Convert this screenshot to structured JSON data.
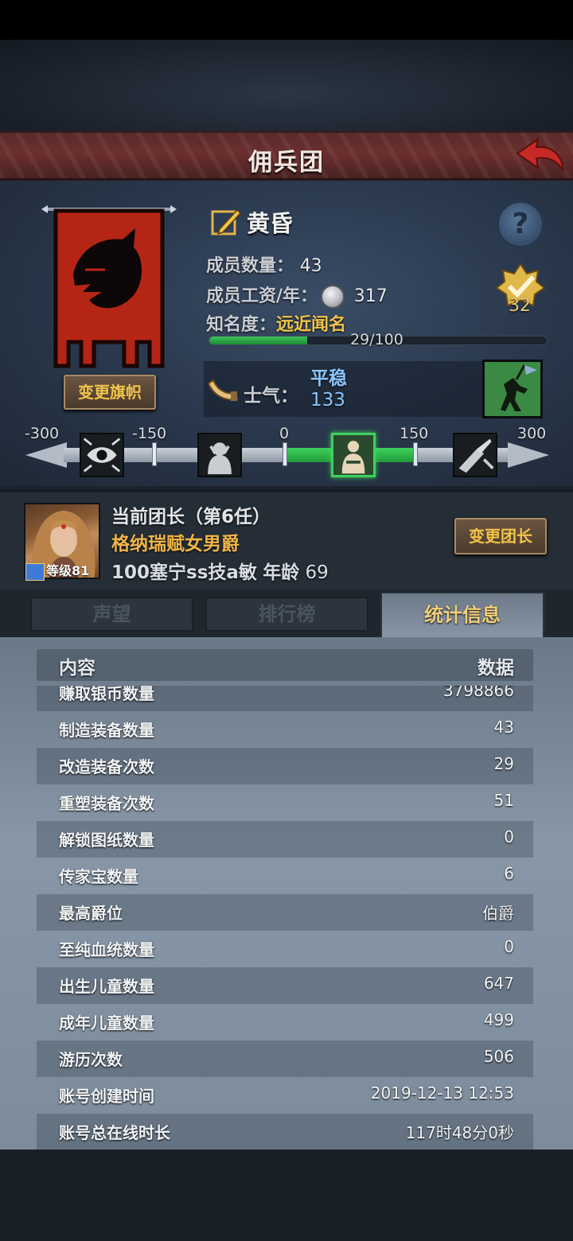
{
  "header": {
    "title": "佣兵团"
  },
  "group": {
    "name": "黄昏",
    "change_flag_label": "变更旗帜",
    "members_label": "成员数量：",
    "members_value": "43",
    "wage_label": "成员工资/年：",
    "wage_value": "317",
    "fame_label": "知名度：",
    "fame_value": "远近闻名",
    "fame_progress": "29/100",
    "fame_fraction": 0.29,
    "rank_value": "32"
  },
  "morale": {
    "label": "士气：",
    "state": "平稳",
    "value": "133",
    "scale_labels": [
      "-300",
      "-150",
      "0",
      "150",
      "300"
    ]
  },
  "leader": {
    "title": "当前团长（第6任）",
    "name": "格纳瑞赋女男爵",
    "level": "等级81",
    "stats": "100塞宁ss技a敏",
    "age_label": "年龄",
    "age_value": "69",
    "change_label": "变更团长"
  },
  "tabs": [
    "声望",
    "排行榜",
    "统计信息"
  ],
  "table": {
    "col_left": "内容",
    "col_right": "数据",
    "rows": [
      {
        "k": "赚取银币数量",
        "v": "3798866"
      },
      {
        "k": "制造装备数量",
        "v": "43"
      },
      {
        "k": "改造装备次数",
        "v": "29"
      },
      {
        "k": "重塑装备次数",
        "v": "51"
      },
      {
        "k": "解锁图纸数量",
        "v": "0"
      },
      {
        "k": "传家宝数量",
        "v": "6"
      },
      {
        "k": "最高爵位",
        "v": "伯爵"
      },
      {
        "k": "至纯血统数量",
        "v": "0"
      },
      {
        "k": "出生儿童数量",
        "v": "647"
      },
      {
        "k": "成年儿童数量",
        "v": "499"
      },
      {
        "k": "游历次数",
        "v": "506"
      },
      {
        "k": "账号创建时间",
        "v": "2019-12-13 12:53"
      },
      {
        "k": "账号总在线时长",
        "v": "117时48分0秒"
      }
    ]
  },
  "colors": {
    "accent_gold": "#f0c44a",
    "morale_blue": "#8dc6ff",
    "progress_green": "#3cc25a",
    "title_red": "#6b2f2e"
  }
}
